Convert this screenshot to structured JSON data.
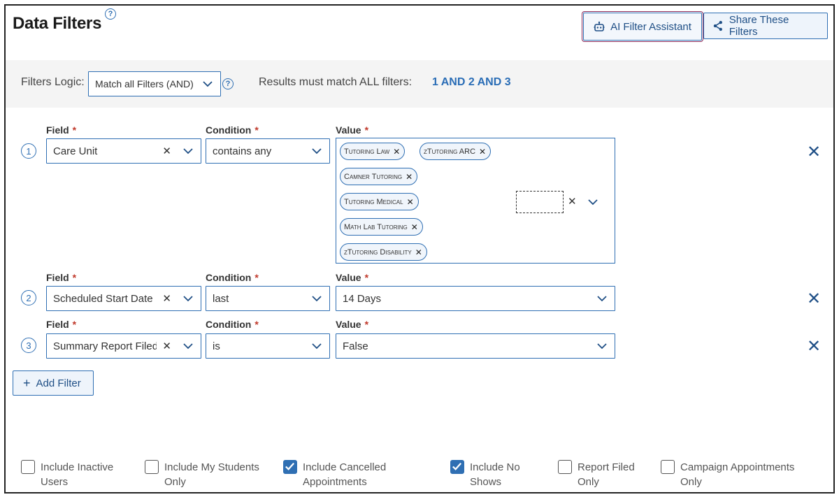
{
  "page": {
    "title": "Data Filters",
    "help": "?"
  },
  "header": {
    "ai_button": "AI Filter Assistant",
    "share_button": "Share These Filters"
  },
  "logic": {
    "label": "Filters Logic:",
    "selected": "Match all Filters (AND)",
    "help": "?",
    "results_label": "Results must match ALL filters:",
    "results_value": "1 AND 2 AND 3"
  },
  "columns": {
    "field": "Field",
    "condition": "Condition",
    "value": "Value",
    "required": "*"
  },
  "filters": [
    {
      "number": "1",
      "field": "Care Unit",
      "condition": "contains any",
      "chips": [
        "Tutoring Law",
        "zTutoring ARC",
        "Camner Tutoring",
        "Tutoring Medical",
        "Math Lab Tutoring",
        "zTutoring Disability"
      ]
    },
    {
      "number": "2",
      "field": "Scheduled Start Date",
      "condition": "last",
      "value": "14 Days"
    },
    {
      "number": "3",
      "field": "Summary Report Filed?",
      "condition": "is",
      "value": "False"
    }
  ],
  "add_filter": "Add Filter",
  "options": [
    {
      "line1": "Include Inactive",
      "line2": "Users",
      "checked": false
    },
    {
      "line1": "Include My Students",
      "line2": "Only",
      "checked": false
    },
    {
      "line1": "Include Cancelled",
      "line2": "Appointments",
      "checked": true
    },
    {
      "line1": "Include No",
      "line2": "Shows",
      "checked": true
    },
    {
      "line1": "Report Filed",
      "line2": "Only",
      "checked": false
    },
    {
      "line1": "Campaign Appointments",
      "line2": "Only",
      "checked": false
    }
  ],
  "icons": {
    "ai": "robot-icon",
    "share": "share-icon",
    "chevron": "chevron-down-icon",
    "clear": "clear-icon",
    "remove": "remove-filter-icon",
    "add": "plus-icon",
    "check": "checkmark-icon"
  },
  "colors": {
    "accent": "#2f6fb3",
    "results": "#2a6db6",
    "required": "#c0392b",
    "logic_bg": "#f4f4f4"
  }
}
